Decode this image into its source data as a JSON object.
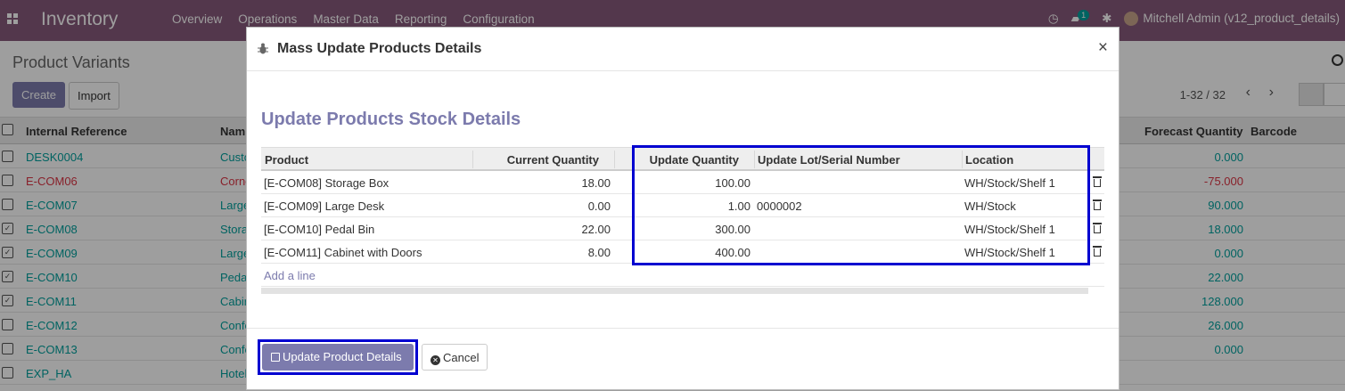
{
  "navbar": {
    "app_name": "Inventory",
    "menu": [
      "Overview",
      "Operations",
      "Master Data",
      "Reporting",
      "Configuration"
    ],
    "chat_badge": "1",
    "user": "Mitchell Admin (v12_product_details)"
  },
  "control_panel": {
    "title": "Product Variants",
    "create_label": "Create",
    "import_label": "Import",
    "pager": "1-32 / 32"
  },
  "list": {
    "headers": {
      "ref": "Internal Reference",
      "name": "Nam",
      "forecast": "Forecast Quantity",
      "barcode": "Barcode"
    },
    "rows": [
      {
        "ref": "DESK0004",
        "name": "Custo",
        "forecast": "0.000",
        "checked": false,
        "red": false
      },
      {
        "ref": "E-COM06",
        "name": "Corne",
        "forecast": "-75.000",
        "checked": false,
        "red": true
      },
      {
        "ref": "E-COM07",
        "name": "Large",
        "forecast": "90.000",
        "checked": false,
        "red": false
      },
      {
        "ref": "E-COM08",
        "name": "Stora",
        "forecast": "18.000",
        "checked": true,
        "red": false
      },
      {
        "ref": "E-COM09",
        "name": "Large",
        "forecast": "0.000",
        "checked": true,
        "red": false
      },
      {
        "ref": "E-COM10",
        "name": "Peda",
        "forecast": "22.000",
        "checked": true,
        "red": false
      },
      {
        "ref": "E-COM11",
        "name": "Cabir",
        "forecast": "128.000",
        "checked": true,
        "red": false
      },
      {
        "ref": "E-COM12",
        "name": "Confe",
        "forecast": "26.000",
        "checked": false,
        "red": false
      },
      {
        "ref": "E-COM13",
        "name": "Confe",
        "forecast": "0.000",
        "checked": false,
        "red": false
      },
      {
        "ref": "EXP_HA",
        "name": "Hotel",
        "forecast": "",
        "checked": false,
        "red": false
      }
    ]
  },
  "modal": {
    "title": "Mass Update Products Details",
    "close": "×",
    "section_title": "Update Products Stock Details",
    "columns": [
      "Product",
      "Current Quantity",
      "Update Quantity",
      "Update Lot/Serial Number",
      "Location"
    ],
    "lines": [
      {
        "product": "[E-COM08] Storage Box",
        "current_qty": "18.00",
        "update_qty": "100.00",
        "lot": "",
        "location": "WH/Stock/Shelf 1"
      },
      {
        "product": "[E-COM09] Large Desk",
        "current_qty": "0.00",
        "update_qty": "1.00",
        "lot": "0000002",
        "location": "WH/Stock"
      },
      {
        "product": "[E-COM10] Pedal Bin",
        "current_qty": "22.00",
        "update_qty": "300.00",
        "lot": "",
        "location": "WH/Stock/Shelf 1"
      },
      {
        "product": "[E-COM11] Cabinet with Doors",
        "current_qty": "8.00",
        "update_qty": "400.00",
        "lot": "",
        "location": "WH/Stock/Shelf 1"
      }
    ],
    "add_line": "Add a line",
    "update_button": "Update Product Details",
    "cancel_button": "Cancel"
  },
  "colors": {
    "primary": "#7c7bad",
    "navbar": "#875a7b",
    "highlight": "#0000d0",
    "link": "#00a09d",
    "danger": "#dc3545"
  }
}
